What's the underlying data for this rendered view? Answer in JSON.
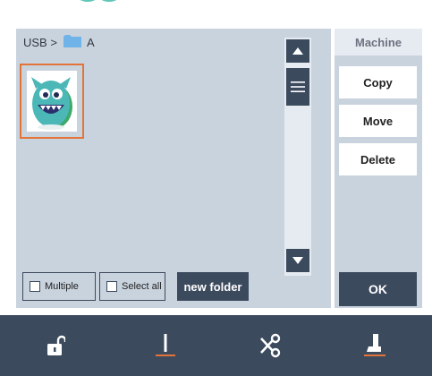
{
  "browser": {
    "path": {
      "root": "USB >",
      "folder": "A"
    },
    "files": [
      {
        "selected": true
      }
    ],
    "buttons": {
      "multiple": "Multiple",
      "select_all": "Select all",
      "new_folder": "new folder"
    }
  },
  "side_panel": {
    "tab": "Machine",
    "actions": {
      "copy": "Copy",
      "move": "Move",
      "delete": "Delete"
    },
    "ok": "OK"
  },
  "toolbar": {
    "icons": [
      "unlock-icon",
      "needle-icon",
      "scissors-icon",
      "presser-foot-icon"
    ]
  },
  "colors": {
    "accent": "#e2743a",
    "dark": "#3c4a5e",
    "panel": "#c9d3de",
    "folder": "#6fb3e8"
  }
}
